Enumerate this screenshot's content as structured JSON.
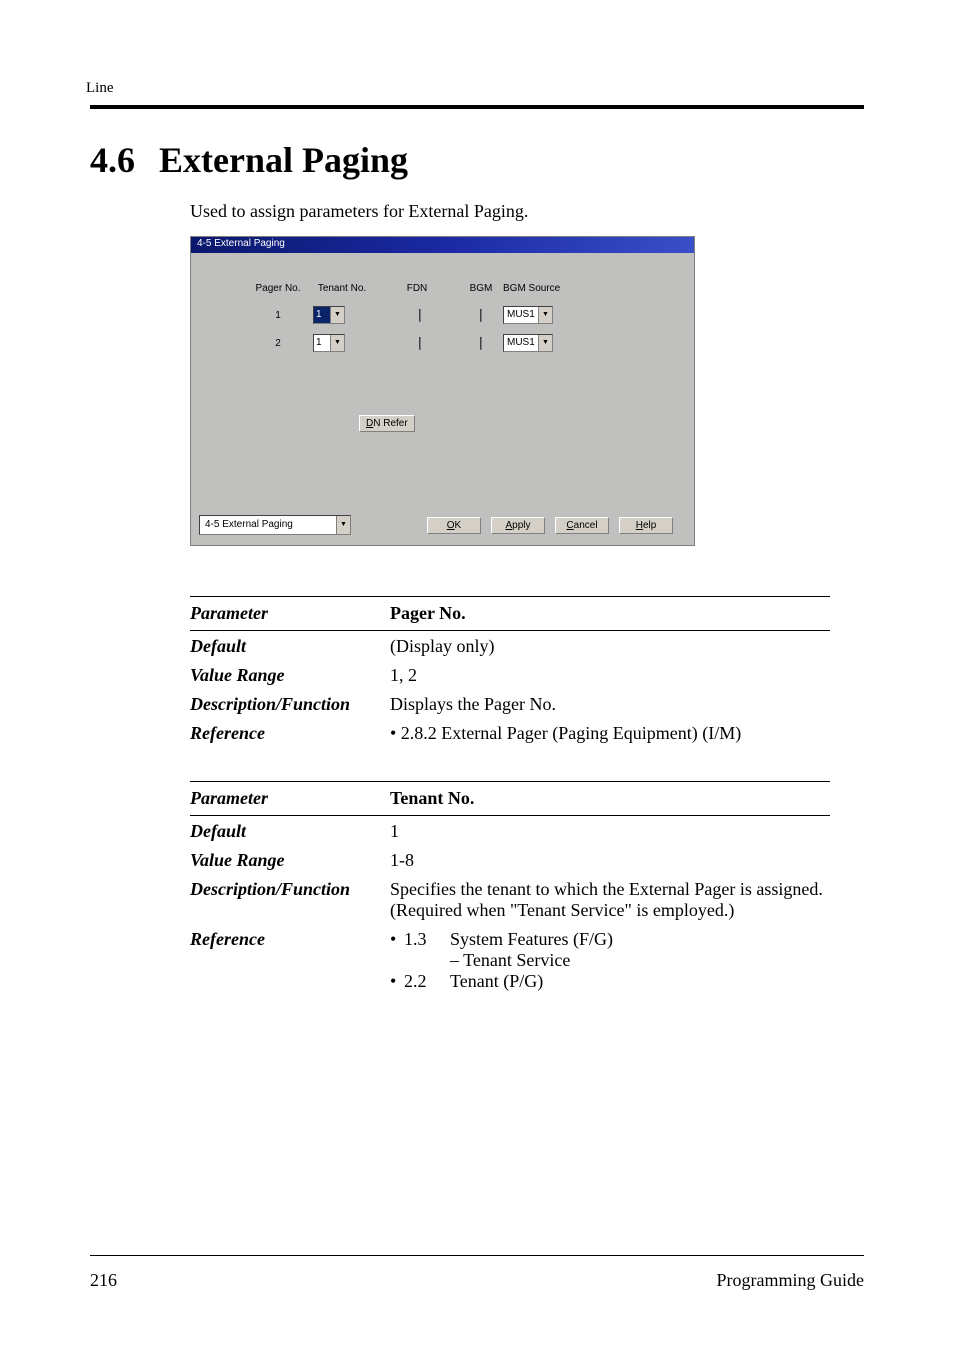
{
  "running_head": "Line",
  "section": {
    "number": "4.6",
    "title": "External Paging"
  },
  "intro": "Used to assign parameters for External Paging.",
  "window": {
    "title": "4-5 External Paging",
    "headers": {
      "pager": "Pager No.",
      "tenant": "Tenant No.",
      "fdn": "FDN",
      "bgm": "BGM",
      "src": "BGM Source"
    },
    "rows": [
      {
        "pager": "1",
        "tenant": "1",
        "fdn": "",
        "bgm_checked": false,
        "src": "MUS1"
      },
      {
        "pager": "2",
        "tenant": "1",
        "fdn": "",
        "bgm_checked": false,
        "src": "MUS1"
      }
    ],
    "dn_refer": {
      "u": "D",
      "rest": "N Refer"
    },
    "footer_select": "4-5 External Paging",
    "buttons": {
      "ok": {
        "u": "O",
        "rest": "K"
      },
      "apply": {
        "u": "A",
        "rest": "pply"
      },
      "cancel": {
        "u": "C",
        "rest": "ancel"
      },
      "help": {
        "u": "H",
        "rest": "elp"
      }
    }
  },
  "tables": [
    {
      "header_label": "Parameter",
      "header_value": "Pager No.",
      "rows": [
        {
          "label": "Default",
          "value": "(Display only)"
        },
        {
          "label": "Value Range",
          "value": "1, 2"
        },
        {
          "label": "Description/Function",
          "value": "Displays the Pager No."
        },
        {
          "label": "Reference",
          "value": "• 2.8.2 External Pager (Paging Equipment) (I/M)"
        }
      ]
    },
    {
      "header_label": "Parameter",
      "header_value": "Tenant No.",
      "rows": [
        {
          "label": "Default",
          "value": "1"
        },
        {
          "label": "Value Range",
          "value": "1-8"
        },
        {
          "label": "Description/Function",
          "value": "Specifies the tenant to which the External Pager is assigned. (Required when \"Tenant Service\" is employed.)"
        },
        {
          "label": "Reference",
          "lines": [
            {
              "bull": "•",
              "num": "1.3",
              "text": "System Features (F/G)"
            },
            {
              "indent": true,
              "text": "– Tenant Service"
            },
            {
              "bull": "•",
              "num": "2.2",
              "text": "Tenant (P/G)"
            }
          ]
        }
      ]
    }
  ],
  "footer": {
    "page": "216",
    "doc": "Programming Guide"
  }
}
